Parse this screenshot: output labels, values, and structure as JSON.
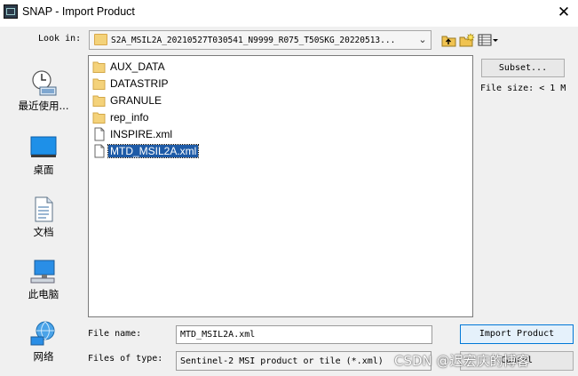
{
  "window": {
    "title": "SNAP - Import Product",
    "close_glyph": "✕"
  },
  "look_in": {
    "label": "Look in:",
    "value": "S2A_MSIL2A_20210527T030541_N9999_R075_T50SKG_20220513...",
    "arrow": "⌄"
  },
  "toolbar": {
    "icons": [
      "up-folder-icon",
      "new-folder-icon",
      "view-menu-icon"
    ]
  },
  "places": [
    {
      "label": "最近使用...",
      "icon": "recent-icon"
    },
    {
      "label": "桌面",
      "icon": "desktop-icon"
    },
    {
      "label": "文档",
      "icon": "documents-icon"
    },
    {
      "label": "此电脑",
      "icon": "computer-icon"
    },
    {
      "label": "网络",
      "icon": "network-icon"
    }
  ],
  "files": [
    {
      "name": "AUX_DATA",
      "type": "folder"
    },
    {
      "name": "DATASTRIP",
      "type": "folder"
    },
    {
      "name": "GRANULE",
      "type": "folder"
    },
    {
      "name": "rep_info",
      "type": "folder"
    },
    {
      "name": "INSPIRE.xml",
      "type": "file"
    },
    {
      "name": "MTD_MSIL2A.xml",
      "type": "file",
      "selected": true
    }
  ],
  "subset": {
    "label": "Subset..."
  },
  "file_size": {
    "label": "File size: < 1 M"
  },
  "file_name": {
    "label": "File name:",
    "value": "MTD_MSIL2A.xml"
  },
  "files_of_type": {
    "label": "Files of type:",
    "value": "Sentinel-2 MSI product or tile (*.xml)"
  },
  "buttons": {
    "import": "Import Product",
    "cancel": "Cancel"
  },
  "watermark": "CSDN @迟宏庆的博客",
  "colors": {
    "selection": "#1e5ba7",
    "folder": "#f3d27a",
    "accent": "#0078d7"
  }
}
